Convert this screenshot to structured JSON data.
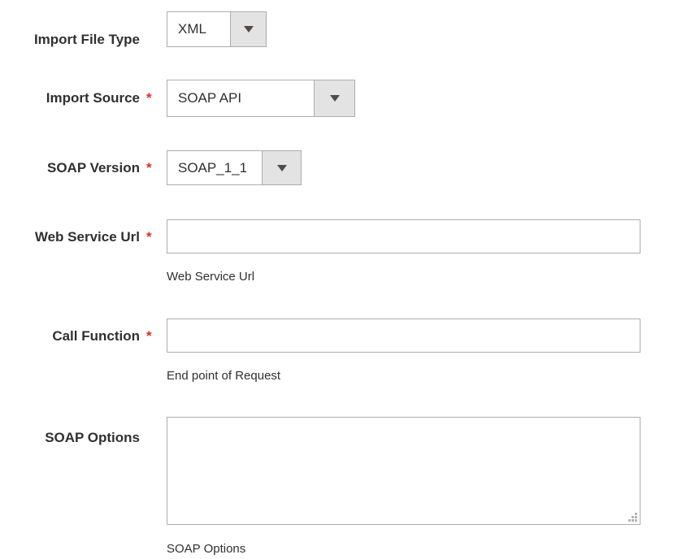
{
  "form": {
    "fields": [
      {
        "id": "import-file-type",
        "label": "Import File Type",
        "required": false,
        "type": "select",
        "value": "XML",
        "note": ""
      },
      {
        "id": "import-source",
        "label": "Import Source",
        "required": true,
        "required_marker": "*",
        "type": "select",
        "value": "SOAP API",
        "note": ""
      },
      {
        "id": "soap-version",
        "label": "SOAP Version",
        "required": true,
        "required_marker": "*",
        "type": "select",
        "value": "SOAP_1_1",
        "note": ""
      },
      {
        "id": "web-service-url",
        "label": "Web Service Url",
        "required": true,
        "required_marker": "*",
        "type": "text",
        "value": "",
        "placeholder": "",
        "note": "Web Service Url"
      },
      {
        "id": "call-function",
        "label": "Call Function",
        "required": true,
        "required_marker": "*",
        "type": "text",
        "value": "",
        "placeholder": "",
        "note": "End point of Request"
      },
      {
        "id": "soap-options",
        "label": "SOAP Options",
        "required": false,
        "type": "textarea",
        "value": "",
        "placeholder": "",
        "note": "SOAP Options"
      }
    ]
  },
  "icons": {
    "dropdown_arrow": "chevron-down-icon",
    "resize_grip": "resize-handle-icon"
  },
  "colors": {
    "required_asterisk": "#e02b27",
    "label_text": "#303030",
    "field_border": "#adadad",
    "select_button_bg": "#e3e3e3",
    "arrow_glyph": "#514943",
    "page_background": "#ffffff"
  }
}
